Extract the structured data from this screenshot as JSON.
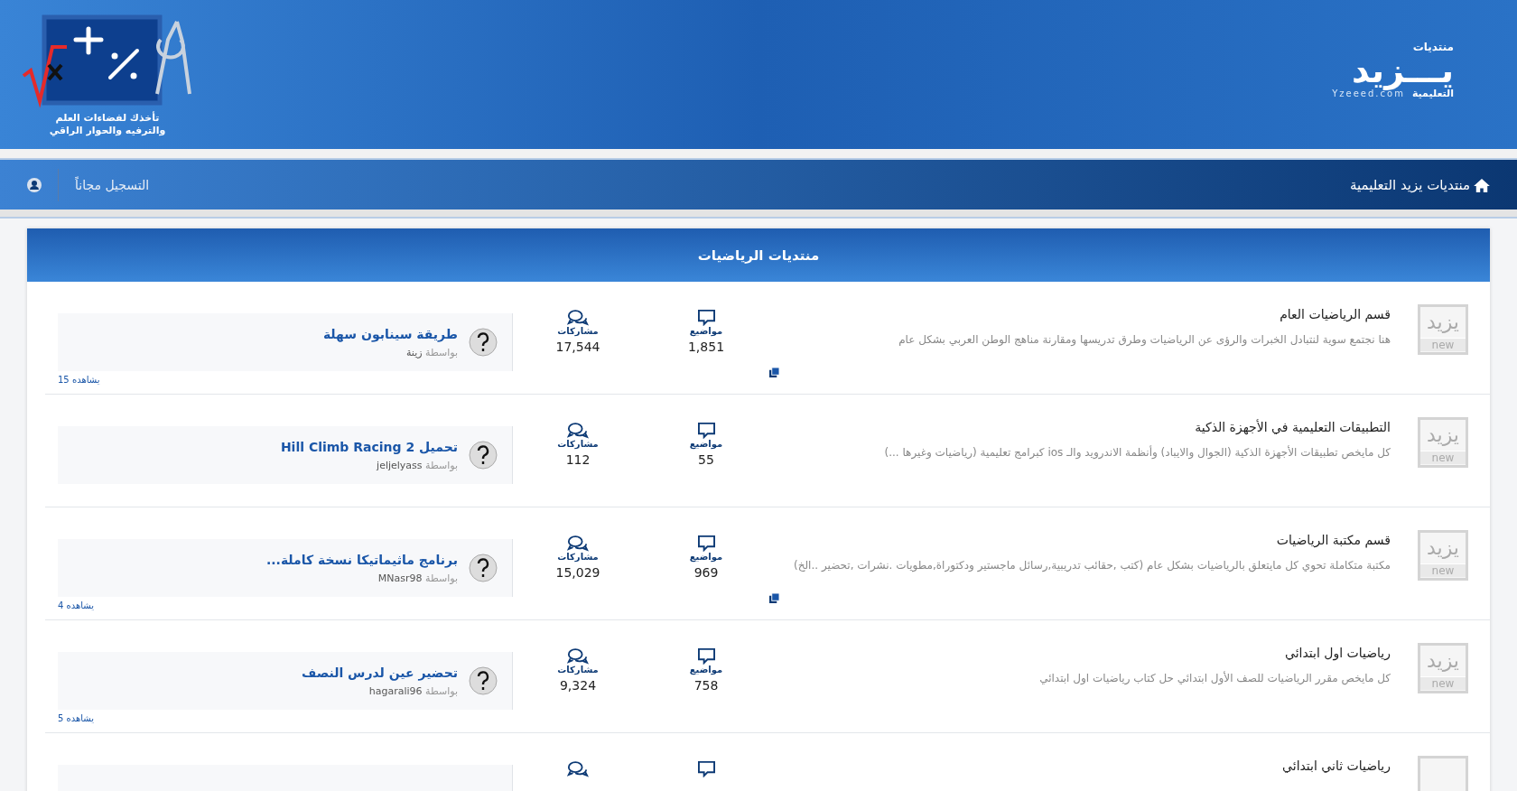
{
  "header": {
    "tagline": [
      "تأخذك لفضاءات العلم",
      "والترفيه والحوار الراقي"
    ],
    "logo": {
      "top": "منتديات",
      "name": "يـــزيد",
      "sub": "التعليمية",
      "domain": "Yzeeed.com"
    }
  },
  "nav": {
    "home": "منتديات يزيد التعليمية",
    "register": "التسجيل مجاناً"
  },
  "section": {
    "title": "منتديات الرياضيات"
  },
  "forums": [
    {
      "title": "قسم الرياضيات العام",
      "description": "هنا نجتمع سوية لنتبادل الخبرات والرؤى عن الرياضيات وطرق تدريسها ومقارنة مناهج الوطن العربي بشكل عام",
      "icon_text": "يزيد",
      "icon_badge": "new",
      "has_subforums": true,
      "topics_label": "مواضيع",
      "topics": "1,851",
      "posts_label": "مشاركات",
      "posts": "17,544",
      "last_post": {
        "title": "طريقة سينابون سهلة",
        "by": "بواسطة",
        "user": "زينة"
      },
      "viewers": "يشاهده 15"
    },
    {
      "title": "التطبيقات التعليمية في الأجهزة الذكية",
      "description": "كل مايخص تطبيقات الأجهزة الذكية (الجوال والايباد) وأنظمة الاندرويد والـ ios كبرامج تعليمية (رياضيات وغيرها ...)",
      "icon_text": "يزيد",
      "icon_badge": "new",
      "has_subforums": false,
      "topics_label": "مواضيع",
      "topics": "55",
      "posts_label": "مشاركات",
      "posts": "112",
      "last_post": {
        "title": "تحميل Hill Climb Racing 2",
        "by": "بواسطة",
        "user": "jeljelyass"
      }
    },
    {
      "title": "قسم مكتبة الرياضيات",
      "description": "مكتبة متكاملة تحوي كل مايتعلق بالرياضيات بشكل عام (كتب ,حقائب تدريبية,رسائل ماجستير ودكتوراة,مطويات .نشرات ,تحضير ..الخ)",
      "icon_text": "يزيد",
      "icon_badge": "new",
      "has_subforums": true,
      "topics_label": "مواضيع",
      "topics": "969",
      "posts_label": "مشاركات",
      "posts": "15,029",
      "last_post": {
        "title": "برنامج ماثيماتيكا نسخة كاملة...",
        "by": "بواسطة",
        "user": "MNasr98"
      },
      "viewers": "يشاهده 4"
    },
    {
      "title": "رياضيات اول ابتدائي",
      "description": "كل مايخص مقرر الرياضيات للصف الأول ابتدائي حل كتاب رياضيات اول ابتدائي",
      "icon_text": "يزيد",
      "icon_badge": "new",
      "has_subforums": false,
      "topics_label": "مواضيع",
      "topics": "758",
      "posts_label": "مشاركات",
      "posts": "9,324",
      "last_post": {
        "title": "تحضير عين لدرس النصف",
        "by": "بواسطة",
        "user": "hagarali96"
      },
      "viewers": "يشاهده 5"
    },
    {
      "title": "رياضيات ثاني ابتدائي",
      "has_subforums": false
    }
  ]
}
